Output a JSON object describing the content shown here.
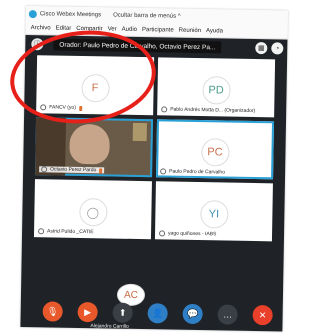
{
  "window": {
    "app_title": "Cisco Webex Meetings",
    "hide_menu_label": "Ocultar barra de menús ^"
  },
  "menu": [
    "Archivo",
    "Editar",
    "Compartir",
    "Ver",
    "Audio",
    "Participante",
    "Reunión",
    "Ayuda"
  ],
  "header": {
    "speaker_text": "Orador: Paulo Pedro de Carvalho, Octavio Perez Pa..."
  },
  "tiles": [
    {
      "initials": "F",
      "name": "FANCV (yo)",
      "initials_color": "#c9714e"
    },
    {
      "initials": "PD",
      "name": "Pablo Andrés Motta D... (Organizador)",
      "initials_color": "#4a9a8a"
    },
    {
      "initials": "",
      "name": "Octavio Perez Pardo"
    },
    {
      "initials": "PC",
      "name": "Paulo Pedro de Carvalho",
      "initials_color": "#c9714e"
    },
    {
      "initials": "",
      "name": "Astrid Pulido _CATIE"
    },
    {
      "initials": "YI",
      "name": "yago quiñones - IABS",
      "initials_color": "#3f8fb0"
    }
  ],
  "partial_tile": {
    "initials": "AC",
    "name": "Alejandro Carrillo"
  },
  "controls": {
    "mute": "mute",
    "video": "video",
    "share": "share",
    "participants": "participants",
    "chat": "chat",
    "more": "more",
    "leave": "leave"
  },
  "colors": {
    "mute": "#e8582a",
    "video": "#e8582a",
    "share": "#3a3f46",
    "participants": "#2f7fc7",
    "chat": "#2f7fc7",
    "more": "#3a3f46",
    "leave": "#e8402a",
    "highlight": "#2aa1d6",
    "annotation": "#e8201a"
  }
}
